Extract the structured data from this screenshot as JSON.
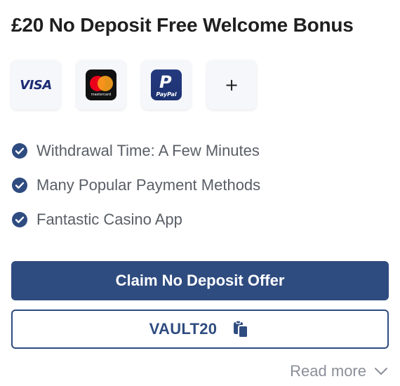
{
  "title": "£20 No Deposit Free Welcome Bonus",
  "payment_methods": [
    {
      "name": "visa",
      "label": "VISA",
      "icon": "visa-logo"
    },
    {
      "name": "mastercard",
      "label": "mastercard",
      "icon": "mastercard-logo"
    },
    {
      "name": "paypal",
      "label": "PayPal",
      "icon": "paypal-logo"
    },
    {
      "name": "more",
      "label": "+",
      "icon": "plus-icon"
    }
  ],
  "features": [
    {
      "label": "Withdrawal Time: A Few Minutes",
      "icon": "check-circle-icon"
    },
    {
      "label": "Many Popular Payment Methods",
      "icon": "check-circle-icon"
    },
    {
      "label": "Fantastic Casino App",
      "icon": "check-circle-icon"
    }
  ],
  "claim_button": {
    "label": "Claim No Deposit Offer"
  },
  "promo_code": {
    "code": "VAULT20",
    "icon": "copy-icon"
  },
  "read_more": {
    "label": "Read more",
    "icon": "chevron-down-icon"
  },
  "colors": {
    "primary": "#2f4c80",
    "feature_text": "#5a5e66",
    "muted": "#8a8f98",
    "tile_bg": "#f6f7fb"
  }
}
